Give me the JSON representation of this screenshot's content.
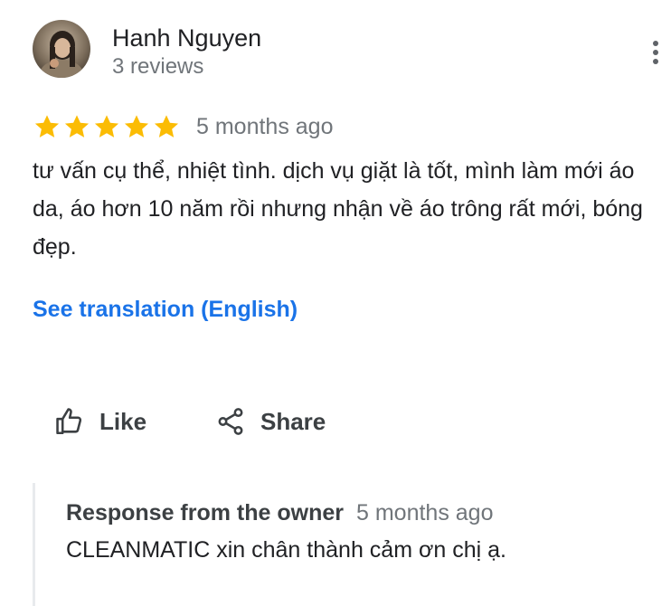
{
  "author": {
    "name": "Hanh Nguyen",
    "meta": "3 reviews"
  },
  "rating": {
    "stars": 5,
    "max": 5,
    "time_ago": "5 months ago"
  },
  "review": {
    "text": "tư vấn cụ thể, nhiệt tình. dịch vụ giặt là tốt, mình làm mới áo da, áo hơn 10 năm rồi nhưng nhận về áo trông rất mới, bóng đẹp.",
    "translate_link": "See translation (English)"
  },
  "actions": {
    "like_label": "Like",
    "share_label": "Share"
  },
  "owner_response": {
    "title": "Response from the owner",
    "time_ago": "5 months ago",
    "text": "CLEANMATIC xin chân thành cảm ơn chị ạ."
  },
  "colors": {
    "star": "#fbbc04",
    "link": "#1a73e8",
    "secondary_text": "#70757a",
    "primary_text": "#202124"
  },
  "icons": {
    "more": "more-vert-icon",
    "like": "thumb-up-icon",
    "share": "share-icon",
    "star": "star-icon"
  }
}
